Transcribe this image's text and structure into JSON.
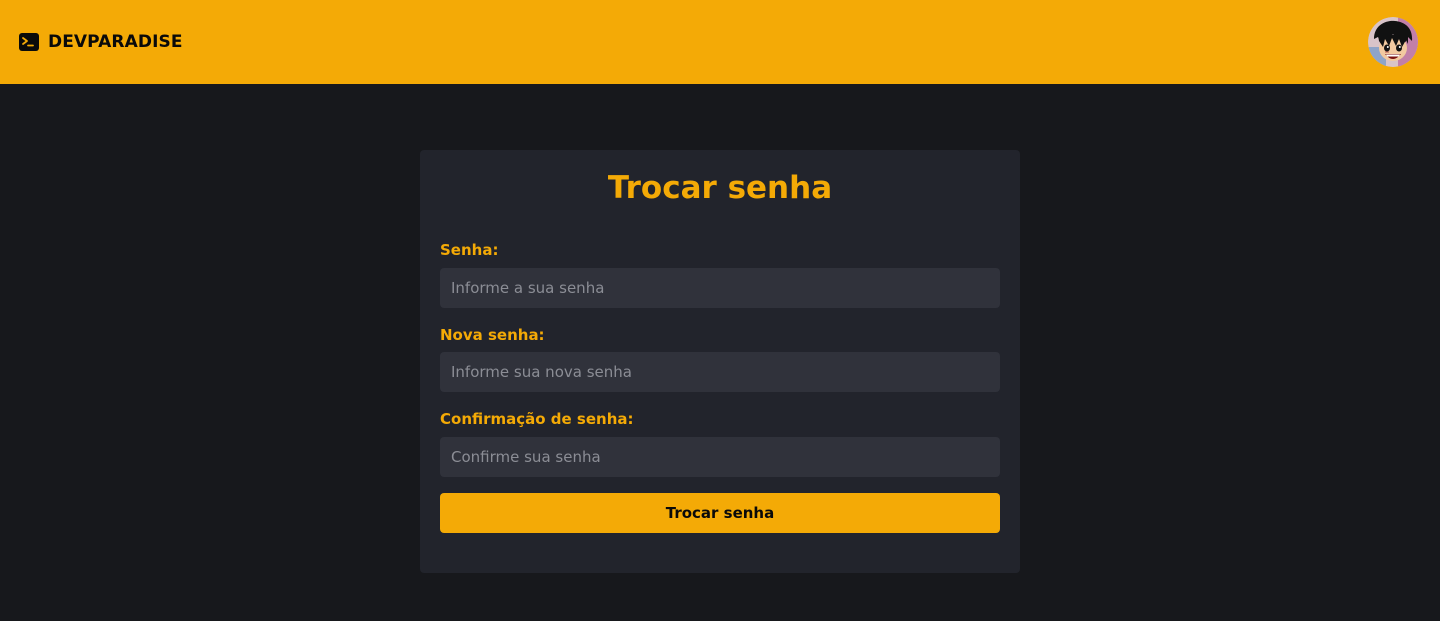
{
  "header": {
    "brand_name": "DEVPARADISE",
    "brand_icon": "terminal-icon",
    "avatar_icon": "user-avatar",
    "background_color": "#f4aa06"
  },
  "form": {
    "title": "Trocar senha",
    "fields": [
      {
        "label": "Senha:",
        "placeholder": "Informe a sua senha",
        "value": ""
      },
      {
        "label": "Nova senha:",
        "placeholder": "Informe sua nova senha",
        "value": ""
      },
      {
        "label": "Confirmação de senha:",
        "placeholder": "Confirme sua senha",
        "value": ""
      }
    ],
    "submit_label": "Trocar senha"
  },
  "colors": {
    "accent": "#f4aa06",
    "page_background": "#17181c",
    "card_background": "#22242c",
    "input_background": "#30323b"
  }
}
